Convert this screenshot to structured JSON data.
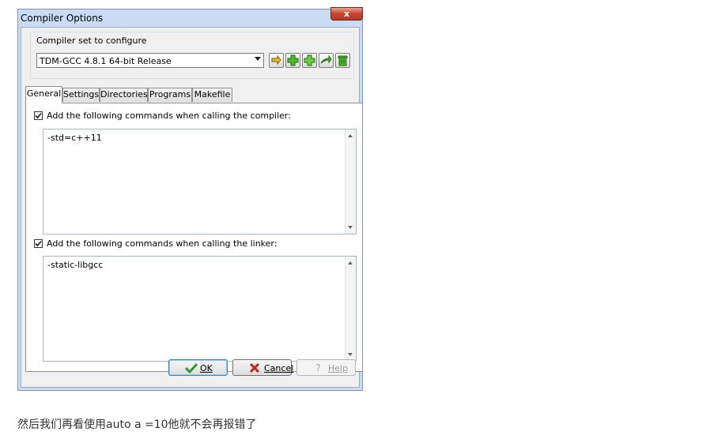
{
  "window": {
    "title": "Compiler Options",
    "close_label": "x"
  },
  "compiler_set": {
    "group_label": "Compiler set to configure",
    "selected": "TDM-GCC 4.8.1 64-bit Release"
  },
  "toolbar": {
    "icons": [
      "rename-icon",
      "add-icon",
      "add-from-folder-icon",
      "find-icon",
      "delete-icon"
    ]
  },
  "tabs": [
    {
      "label": "General",
      "active": true
    },
    {
      "label": "Settings",
      "active": false
    },
    {
      "label": "Directories",
      "active": false
    },
    {
      "label": "Programs",
      "active": false
    },
    {
      "label": "Makefile",
      "active": false
    }
  ],
  "general": {
    "compiler_check": {
      "label": "Add the following commands when calling the compiler:",
      "checked": true
    },
    "compiler_commands": "-std=c++11",
    "linker_check": {
      "label": "Add the following commands when calling the linker:",
      "checked": true
    },
    "linker_commands": "-static-libgcc"
  },
  "buttons": {
    "ok": "OK",
    "cancel": "Cancel",
    "help": "Help"
  },
  "colors": {
    "title_bg": "#c9dcf2",
    "close_red": "#c8452f",
    "ok_green": "#2f9a2f",
    "cancel_red": "#c81e1e"
  },
  "caption": "然后我们再看使用auto a =10他就不会再报错了"
}
